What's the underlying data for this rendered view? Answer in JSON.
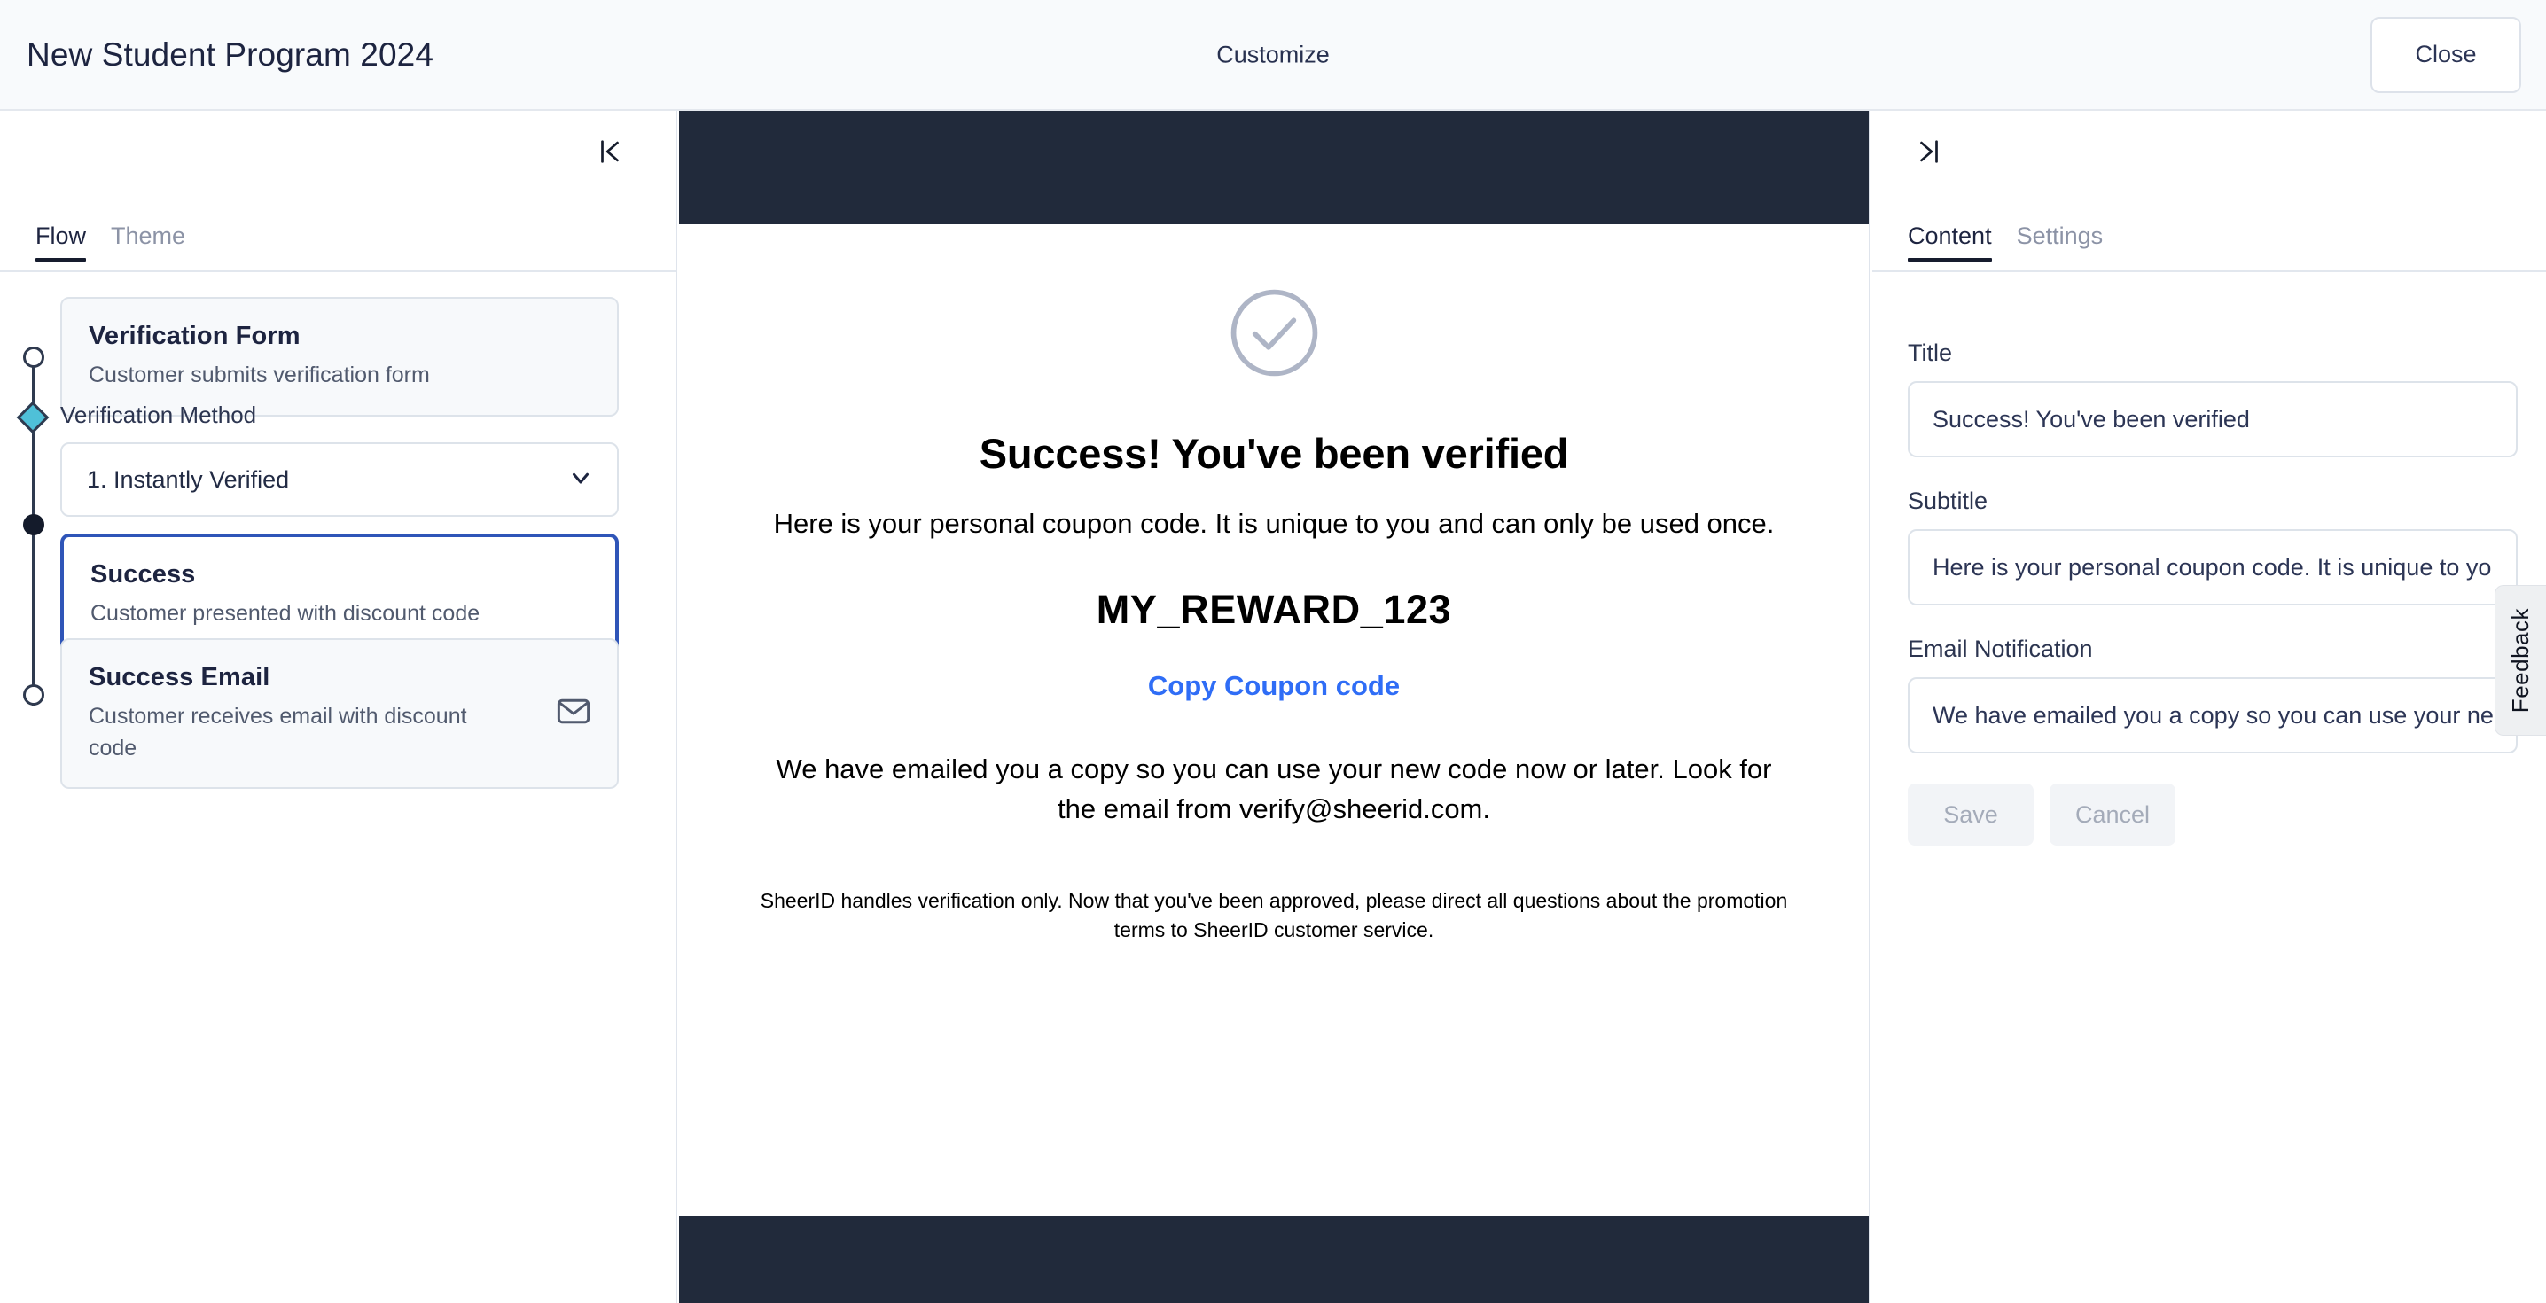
{
  "topbar": {
    "title": "New Student Program 2024",
    "center_label": "Customize",
    "close_label": "Close"
  },
  "left_panel": {
    "collapse_icon": "collapse-left-icon",
    "tabs": [
      {
        "label": "Flow",
        "active": true
      },
      {
        "label": "Theme",
        "active": false
      }
    ],
    "flow_steps": [
      {
        "title": "Verification Form",
        "description": "Customer submits verification form",
        "selected": false,
        "node": "hollow"
      },
      {
        "title": "Success",
        "description": "Customer presented with discount code",
        "selected": true,
        "node": "filled"
      },
      {
        "title": "Success Email",
        "description": "Customer receives email with discount code",
        "selected": false,
        "node": "hollow",
        "icon": "mail-icon"
      }
    ],
    "verification_method": {
      "label": "Verification Method",
      "selected_value": "1. Instantly Verified",
      "chevron_icon": "chevron-down-icon"
    }
  },
  "preview": {
    "check_icon": "check-circle-icon",
    "title": "Success! You've been verified",
    "subtitle": "Here is your personal coupon code. It is unique to you and can only be used once.",
    "coupon_code": "MY_REWARD_123",
    "copy_link": "Copy Coupon code",
    "email_note": "We have emailed you a copy so you can use your new code now or later. Look for the email from verify@sheerid.com.",
    "fine_print": "SheerID handles verification only. Now that you've been approved, please direct all questions about the promotion terms to SheerID customer service."
  },
  "right_panel": {
    "collapse_icon": "collapse-right-icon",
    "tabs": [
      {
        "label": "Content",
        "active": true
      },
      {
        "label": "Settings",
        "active": false
      }
    ],
    "fields": [
      {
        "label": "Title",
        "value": "Success! You've been verified",
        "name": "title-field"
      },
      {
        "label": "Subtitle",
        "value": "Here is your personal coupon code. It is unique to you and can only be used once.",
        "name": "subtitle-field"
      },
      {
        "label": "Email Notification",
        "value": "We have emailed you a copy so you can use your new code now or later. Look for the email from verify@sheerid.com.",
        "name": "email-notification-field"
      }
    ],
    "save_label": "Save",
    "cancel_label": "Cancel"
  },
  "feedback": {
    "label": "Feedback"
  },
  "colors": {
    "accent_blue": "#2f55b8",
    "link_blue": "#2f6df6",
    "diamond_cyan": "#4fc0d8",
    "dark_band": "#212a3b",
    "text_dark": "#1d2440"
  }
}
